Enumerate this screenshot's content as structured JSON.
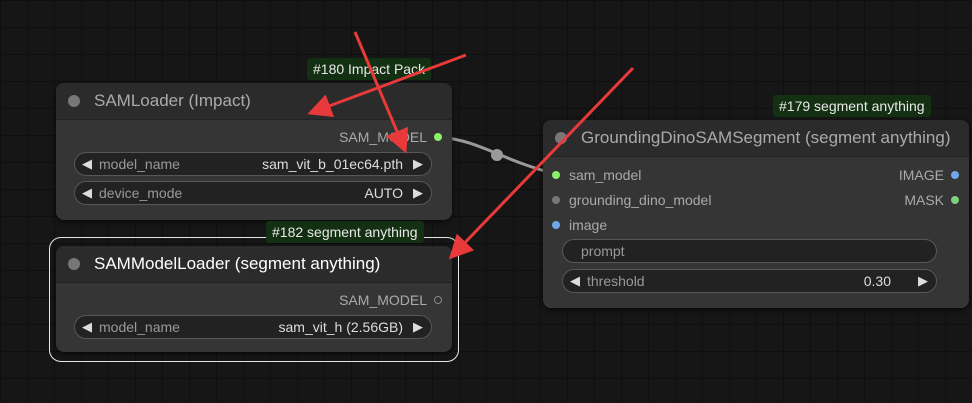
{
  "badges": {
    "impact": "#180 Impact Pack",
    "grounding": "#179 segment anything",
    "sam_model_loader": "#182 segment anything"
  },
  "nodes": {
    "sam_loader": {
      "title": "SAMLoader (Impact)",
      "output": "SAM_MODEL",
      "widgets": [
        {
          "label": "model_name",
          "value": "sam_vit_b_01ec64.pth"
        },
        {
          "label": "device_mode",
          "value": "AUTO"
        }
      ]
    },
    "sam_model_loader": {
      "title": "SAMModelLoader (segment anything)",
      "output": "SAM_MODEL",
      "widgets": [
        {
          "label": "model_name",
          "value": "sam_vit_h (2.56GB)"
        }
      ]
    },
    "grounding_dino": {
      "title": "GroundingDinoSAMSegment (segment anything)",
      "inputs": [
        "sam_model",
        "grounding_dino_model",
        "image"
      ],
      "outputs": [
        "IMAGE",
        "MASK"
      ],
      "prompt_placeholder": "prompt",
      "threshold": {
        "label": "threshold",
        "value": "0.30"
      }
    }
  },
  "colors": {
    "sam_model_slot": "#8cf06a",
    "image_slot": "#6fa8e8",
    "mask_slot": "#7ad17a",
    "unconnected_slot": "#777777",
    "annotation_arrow": "#e83a3a",
    "badge_bg": "#143012"
  },
  "icons": {
    "left_arrow": "◀",
    "right_arrow": "▶"
  }
}
